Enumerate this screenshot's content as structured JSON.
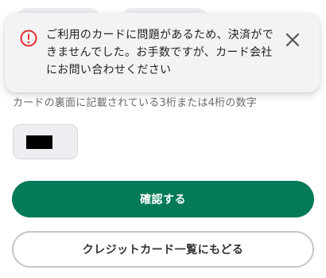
{
  "toast": {
    "message": "ご利用のカードに問題があるため、決済ができませんでした。お手数ですが、カード会社にお問い合わせください",
    "icon": "error-icon",
    "icon_color": "#e52b2b",
    "close_icon": "close-icon"
  },
  "cvv": {
    "hint": "カードの裏面に記載されている3桁または4桁の数字"
  },
  "buttons": {
    "confirm_label": "確認する",
    "back_label": "クレジットカード一覧にもどる"
  },
  "colors": {
    "primary": "#047a58",
    "error": "#e52b2b"
  }
}
